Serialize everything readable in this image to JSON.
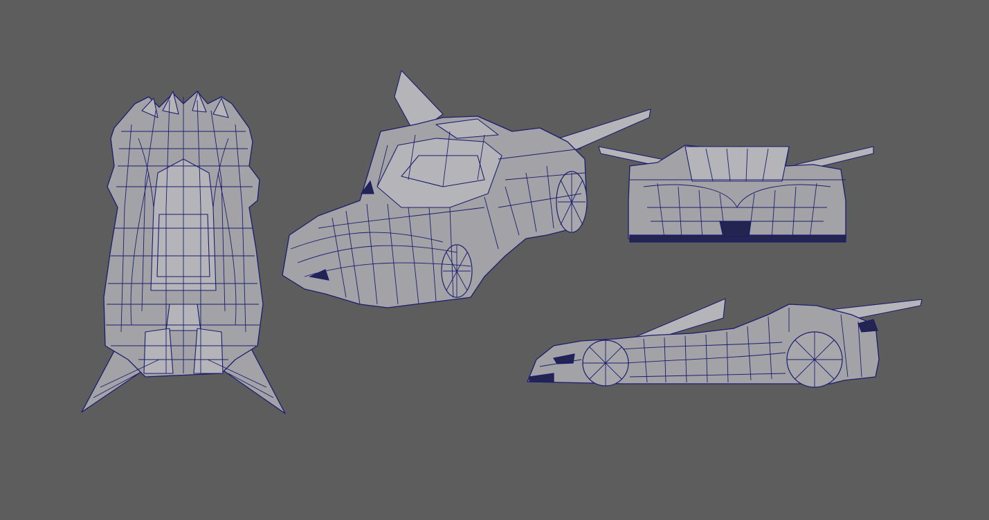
{
  "viewport": {
    "background": "#5d5d5d",
    "wireframe_color": "#1b1c6e",
    "shaded_color": "#a2a2a7"
  },
  "model": {
    "views": [
      {
        "id": "top",
        "view": "top"
      },
      {
        "id": "perspective",
        "view": "perspective"
      },
      {
        "id": "front",
        "view": "front"
      },
      {
        "id": "side",
        "view": "side"
      }
    ]
  }
}
